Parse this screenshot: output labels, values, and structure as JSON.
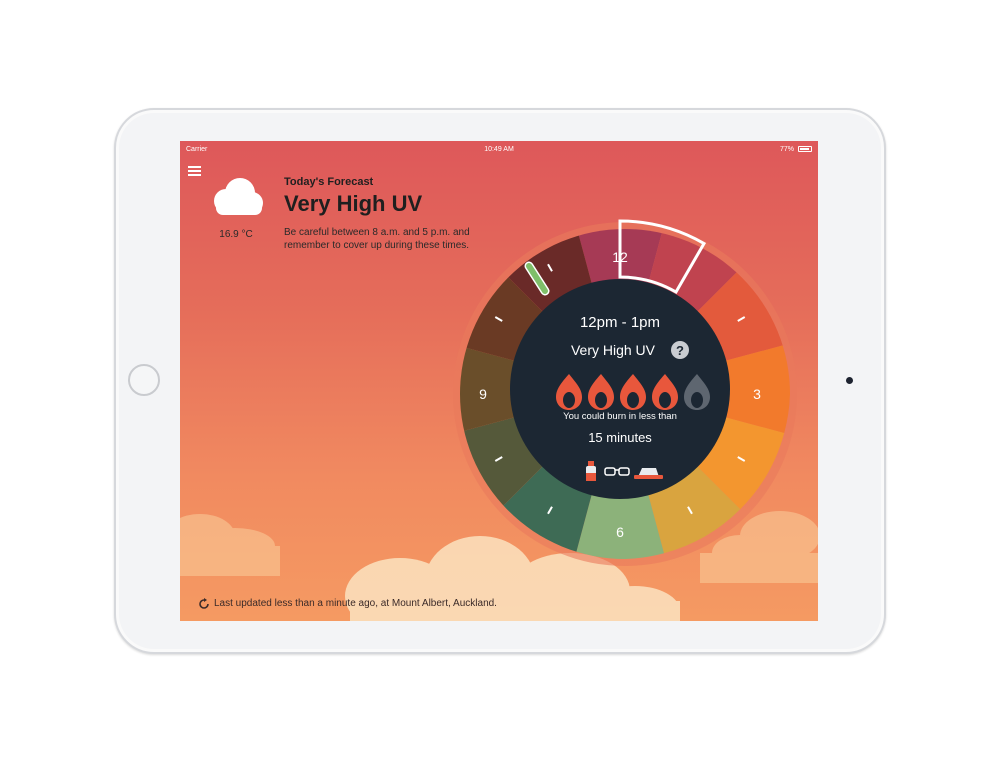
{
  "status_bar": {
    "carrier": "Carrier",
    "time": "10:49 AM",
    "battery": "77%"
  },
  "weather": {
    "icon": "cloud-icon",
    "temperature": "16.9 °C"
  },
  "forecast": {
    "label": "Today's Forecast",
    "title": "Very High UV",
    "description": "Be careful between 8 a.m. and 5 p.m. and remember to cover up during these times."
  },
  "dial": {
    "hour_labels": {
      "top": "12",
      "right": "3",
      "bottom": "6",
      "left": "9"
    },
    "selected_time": "12pm - 1pm",
    "uv_level": "Very High UV",
    "help_icon": "question-icon",
    "flames_active": 4,
    "flames_total": 5,
    "burn_text": "You could burn in less than",
    "burn_time": "15 minutes",
    "protection_icons": [
      "sunscreen-icon",
      "sunglasses-icon",
      "hat-icon"
    ],
    "colors": {
      "center": "#1c2733",
      "flame_active": "#e8573c",
      "flame_inactive": "#5e6670",
      "selection_outline": "#ffffff",
      "indicator": "#7fbf6a"
    }
  },
  "footer": {
    "icon": "refresh-icon",
    "text": "Last updated less than a minute ago, at Mount Albert, Auckland."
  }
}
